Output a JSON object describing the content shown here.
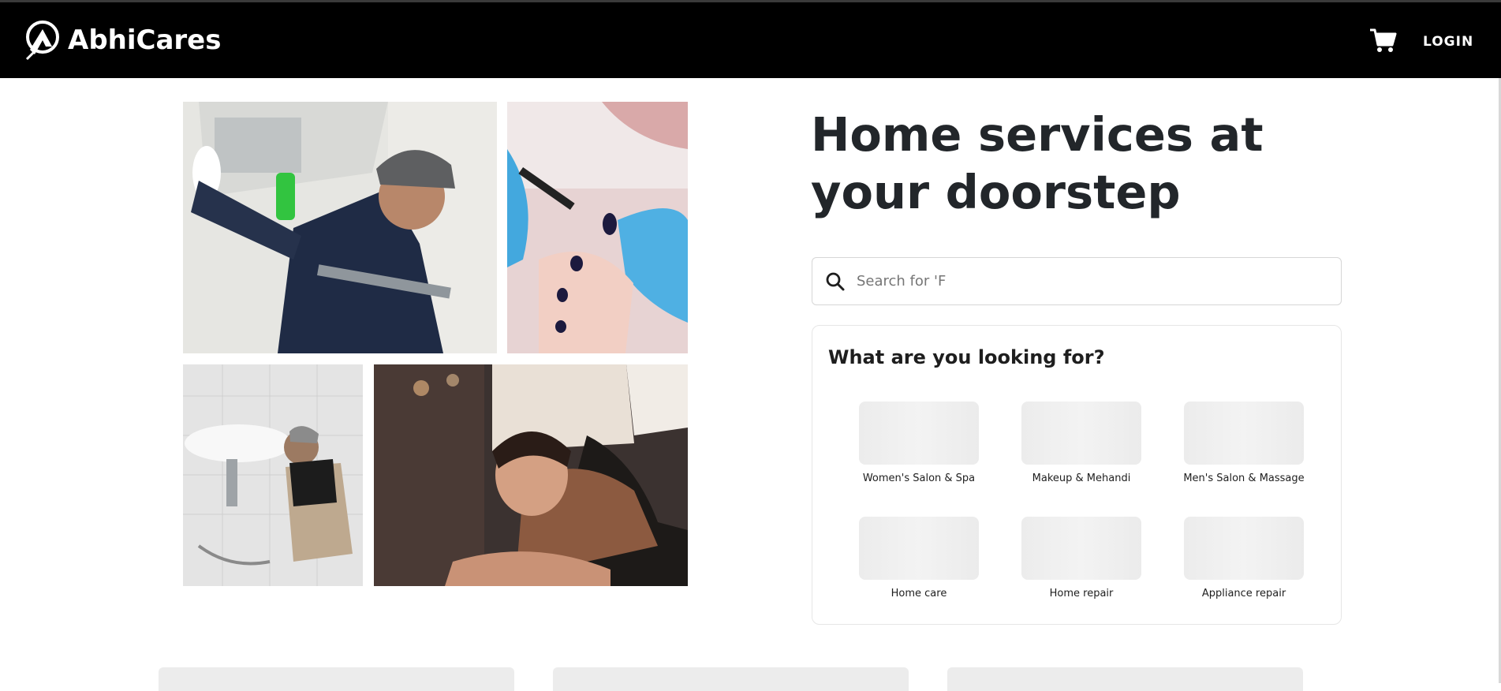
{
  "header": {
    "brand": "AbhiCares",
    "login_label": "LOGIN"
  },
  "hero": {
    "title": "Home services at your doorstep",
    "search": {
      "placeholder": "Search for 'F"
    }
  },
  "categories": {
    "title": "What are you looking for?",
    "items": [
      {
        "label": "Women's Salon & Spa"
      },
      {
        "label": "Makeup & Mehandi"
      },
      {
        "label": "Men's Salon & Massage"
      },
      {
        "label": "Home care"
      },
      {
        "label": "Home repair"
      },
      {
        "label": "Appliance repair"
      }
    ]
  },
  "icons": {
    "logo": "abhicares-logo-icon",
    "cart": "cart-icon",
    "search": "search-icon"
  },
  "colors": {
    "navbar": "#000000",
    "text_dark": "#22262a",
    "placeholder_tile": "#ececec"
  }
}
